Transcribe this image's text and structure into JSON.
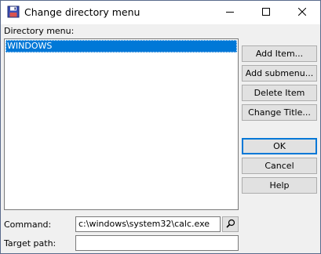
{
  "window": {
    "title": "Change directory menu"
  },
  "directory_menu": {
    "label": "Directory menu:",
    "items": [
      "WINDOWS"
    ],
    "selected_index": 0
  },
  "buttons": {
    "add_item": "Add Item...",
    "add_submenu": "Add submenu...",
    "delete_item": "Delete Item",
    "change_title": "Change Title...",
    "ok": "OK",
    "cancel": "Cancel",
    "help": "Help"
  },
  "command": {
    "label": "Command:",
    "value": "c:\\windows\\system32\\calc.exe"
  },
  "target_path": {
    "label": "Target path:",
    "value": ""
  },
  "icons": {
    "app": "floppy-disk-icon",
    "browse": "magnifier-icon",
    "minimize": "minimize-icon",
    "maximize": "maximize-icon",
    "close": "close-icon"
  },
  "colors": {
    "selection": "#0078d7",
    "default_button_border": "#0078d7"
  }
}
